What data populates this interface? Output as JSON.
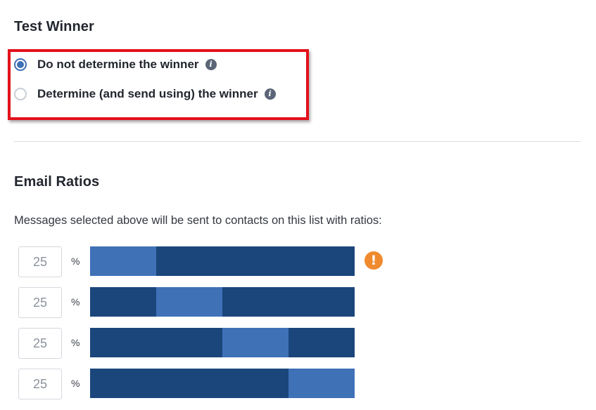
{
  "test_winner": {
    "title": "Test Winner",
    "options": [
      {
        "label": "Do not determine the winner",
        "checked": true,
        "info_icon": "info-icon"
      },
      {
        "label": "Determine (and send using) the winner",
        "checked": false,
        "info_icon": "info-icon"
      }
    ],
    "info_glyph": "i"
  },
  "email_ratios": {
    "title": "Email Ratios",
    "description": "Messages selected above will be sent to contacts on this list with ratios:",
    "percent_symbol": "%",
    "warning_glyph": "!",
    "rows": [
      {
        "value": "25",
        "segment_index": 0,
        "warning": true
      },
      {
        "value": "25",
        "segment_index": 1,
        "warning": false
      },
      {
        "value": "25",
        "segment_index": 2,
        "warning": false
      },
      {
        "value": "25",
        "segment_index": 3,
        "warning": false
      }
    ]
  },
  "colors": {
    "bar_base": "#1b467c",
    "bar_segment": "#3f71b7",
    "radio_accent": "#3d6fb6",
    "highlight_border": "#e3111b",
    "warning": "#ef8a2e"
  }
}
